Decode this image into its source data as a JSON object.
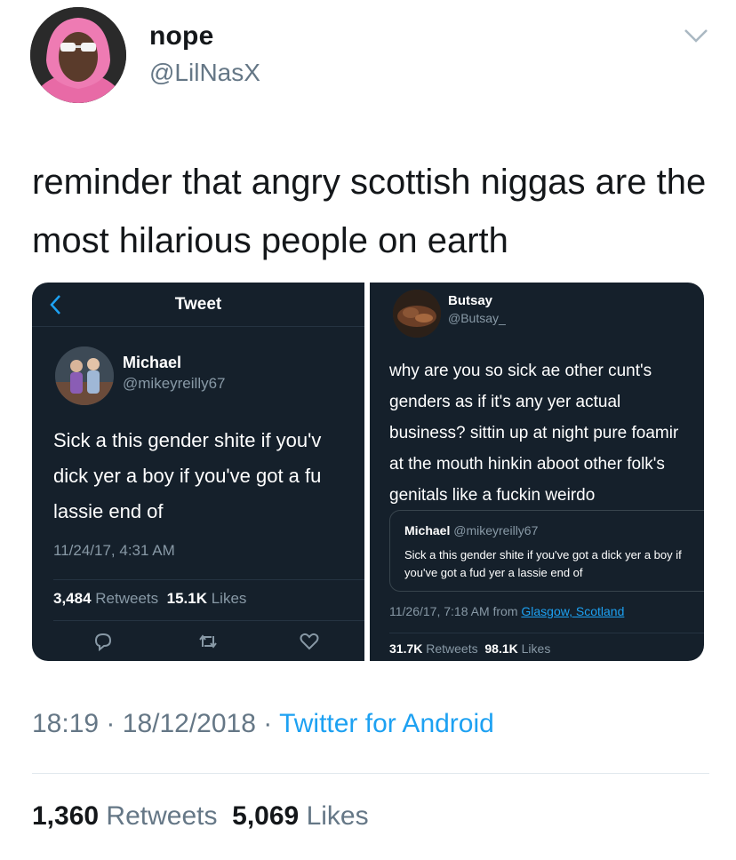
{
  "author": {
    "display_name": "nope",
    "handle": "@LilNasX",
    "avatar_icon": "user-avatar-photo",
    "menu_icon": "chevron-down-icon"
  },
  "tweet": {
    "text": "reminder that angry scottish niggas are the most hilarious people on earth"
  },
  "embedded_left": {
    "nav_title": "Tweet",
    "back_icon": "chevron-left-icon",
    "name": "Michael",
    "handle": "@mikeyreilly67",
    "text_lines": [
      "Sick a this gender shite if you'v",
      "dick yer a boy if you've got a fu",
      "lassie end of"
    ],
    "timestamp": "11/24/17, 4:31 AM",
    "retweets_count": "3,484",
    "retweets_label": "Retweets",
    "likes_count": "15.1K",
    "likes_label": "Likes",
    "action_icons": [
      "reply-icon",
      "retweet-icon",
      "like-icon"
    ]
  },
  "embedded_right": {
    "name": "Butsay",
    "handle": "@Butsay_",
    "text": "why are you so sick ae other cunt's\ngenders as if it's any yer actual\nbusiness? sittin up at night pure foamir\nat the mouth hinkin aboot other folk's\ngenitals like a fuckin weirdo",
    "quote": {
      "name": "Michael",
      "handle": "@mikeyreilly67",
      "text": "Sick a this gender shite if you've got a dick yer a boy if you've got a fud yer a lassie end of"
    },
    "timestamp": "11/26/17, 7:18 AM from",
    "location": "Glasgow, Scotland",
    "retweets_count": "31.7K",
    "retweets_label": "Retweets",
    "likes_count": "98.1K",
    "likes_label": "Likes"
  },
  "meta": {
    "time": "18:19",
    "date": "18/12/2018",
    "separator": "·",
    "source": "Twitter for Android"
  },
  "engagement": {
    "retweets_count": "1,360",
    "retweets_label": "Retweets",
    "likes_count": "5,069",
    "likes_label": "Likes"
  },
  "colors": {
    "accent": "#1da1f2",
    "dark_bg": "#15202b",
    "muted": "#657786"
  }
}
